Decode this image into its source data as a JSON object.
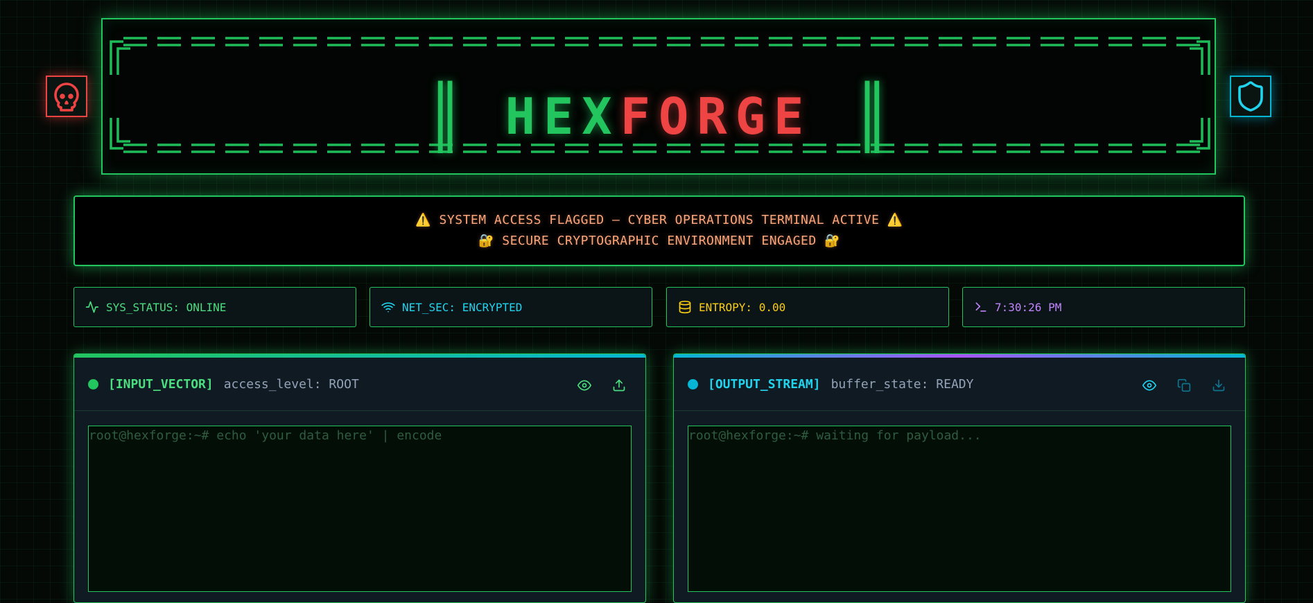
{
  "header": {
    "left_icon": "skull-icon",
    "right_icon": "shield-icon",
    "title_left_bar": "║",
    "title_part1": "HEX",
    "title_part2": "FORGE",
    "title_right_bar": "║"
  },
  "alert": {
    "line1": "⚠️ SYSTEM ACCESS FLAGGED — CYBER OPERATIONS TERMINAL ACTIVE ⚠️",
    "line2": "🔐 SECURE CRYPTOGRAPHIC ENVIRONMENT ENGAGED 🔐"
  },
  "status": [
    {
      "icon": "activity-icon",
      "label": "SYS_STATUS: ONLINE",
      "color": "#4ade80"
    },
    {
      "icon": "wifi-icon",
      "label": "NET_SEC: ENCRYPTED",
      "color": "#22d3ee"
    },
    {
      "icon": "database-icon",
      "label": "ENTROPY: 0.00",
      "color": "#facc15"
    },
    {
      "icon": "terminal-icon",
      "label": "7:30:26 PM",
      "color": "#c084fc"
    }
  ],
  "input_panel": {
    "title": "[INPUT_VECTOR]",
    "meta": "access_level: ROOT",
    "placeholder": "root@hexforge:~# echo 'your data here' | encode",
    "accent": "#22c55e",
    "actions": [
      "eye-icon",
      "upload-icon"
    ]
  },
  "output_panel": {
    "title": "[OUTPUT_STREAM]",
    "meta": "buffer_state: READY",
    "placeholder": "root@hexforge:~# waiting for payload...",
    "accent": "#22d3ee",
    "actions": [
      "eye-icon",
      "copy-icon",
      "download-icon"
    ]
  },
  "colors": {
    "green": "#22c55e",
    "red": "#ef4444",
    "cyan": "#06b6d4",
    "yellow": "#facc15",
    "purple": "#a855f7",
    "alert_text": "#fca57a"
  }
}
